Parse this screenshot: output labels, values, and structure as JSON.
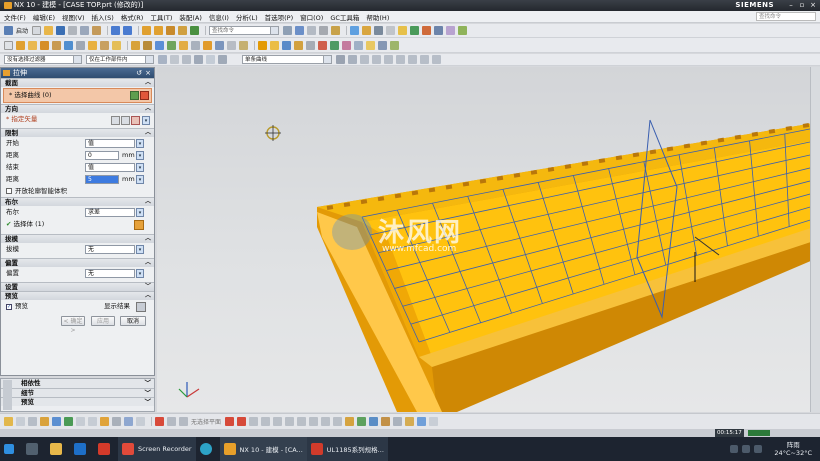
{
  "titlebar": {
    "title": "NX 10 - 建模 - [CASE TOP.prt  (修改的)]",
    "brand": "SIEMENS"
  },
  "menu": {
    "items": [
      "文件(F)",
      "编辑(E)",
      "视图(V)",
      "插入(S)",
      "格式(R)",
      "工具(T)",
      "装配(A)",
      "信息(I)",
      "分析(L)",
      "首选项(P)",
      "窗口(O)",
      "GC工具箱",
      "帮助(H)"
    ],
    "search_placeholder": "查找命令"
  },
  "toolbar": {
    "start_label": "启动",
    "filter_label": "没有选择过滤器",
    "scope_label": "仅在工作部件内",
    "curve_rule": "单条曲线"
  },
  "dialog": {
    "title": "拉伸",
    "sections": {
      "section": "截面",
      "direction": "方向",
      "limits": "限制",
      "boolean": "布尔",
      "draft": "拔模",
      "offset": "偏置",
      "settings": "设置",
      "preview": "预览"
    },
    "select_curve": "* 选择曲线 (0)",
    "specify_vector": "* 指定矢量",
    "start_label": "开始",
    "start_value": "值",
    "distance_label": "距离",
    "distance_start": "0",
    "unit": "mm",
    "end_label": "结束",
    "end_value": "值",
    "distance_end": "5",
    "open_profile": "开放轮廓智能体积",
    "boolean_label": "布尔",
    "boolean_value": "求差",
    "select_body": "选择体 (1)",
    "draft_label": "拔模",
    "draft_value": "无",
    "offset_label": "偏置",
    "offset_value": "无",
    "preview_check": "预览",
    "show_result": "显示结果",
    "ok": "< 确定 >",
    "apply": "应用",
    "cancel": "取消"
  },
  "lower_panel": {
    "items": [
      "相依性",
      "细节",
      "预览"
    ]
  },
  "bottombar": {
    "feature_label": "无选择平面"
  },
  "taskbar": {
    "apps": [
      "Screen Recorder",
      "NX 10 - 建模 - [CA...",
      "UL1185系列规格..."
    ],
    "time": "00:15:17",
    "weather": "阵雨",
    "temp": "24°C~32°C"
  },
  "watermark": {
    "main": "沐风网",
    "url": "www.mfcad.com"
  },
  "colors": {
    "accent": "#ffc20e",
    "part_side": "#e39a06",
    "grid_line": "#3a5fb0",
    "dialog_title": "#3a5a82"
  }
}
